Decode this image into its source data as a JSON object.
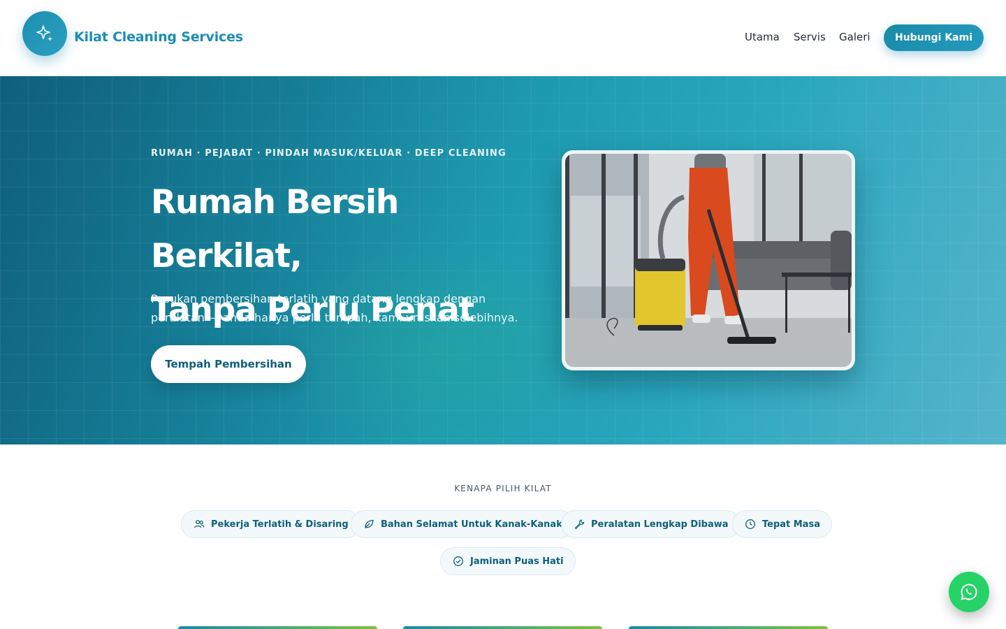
{
  "header": {
    "brand": "Kilat Cleaning Services",
    "logo_icon": "sparkle-icon",
    "nav": [
      "Utama",
      "Servis",
      "Galeri"
    ],
    "cta": "Hubungi Kami"
  },
  "hero": {
    "eyebrow": "RUMAH · PEJABAT · PINDAH MASUK/KELUAR · DEEP CLEANING",
    "headline_line1": "Rumah Bersih Berkilat,",
    "headline_line2": "Tanpa Perlu Penat",
    "subtext": "Pasukan pembersihan terlatih yang datang lengkap dengan peralatan — anda hanya perlu tempah, kami uruskan selebihnya.",
    "cta": "Tempah Pembersihan"
  },
  "why": {
    "title": "KENAPA PILIH KILAT",
    "items": [
      {
        "label": "Pekerja Terlatih & Disaring",
        "icon": "users-icon"
      },
      {
        "label": "Bahan Selamat Untuk Kanak-Kanak",
        "icon": "leaf-icon"
      },
      {
        "label": "Peralatan Lengkap Dibawa",
        "icon": "wrench-icon"
      },
      {
        "label": "Tepat Masa",
        "icon": "clock-icon"
      },
      {
        "label": "Jaminan Puas Hati",
        "icon": "check-circle-icon"
      }
    ]
  },
  "colors": {
    "accent": "#1c8db3",
    "hero_dark": "#0f5f7c",
    "whatsapp": "#25d366"
  }
}
